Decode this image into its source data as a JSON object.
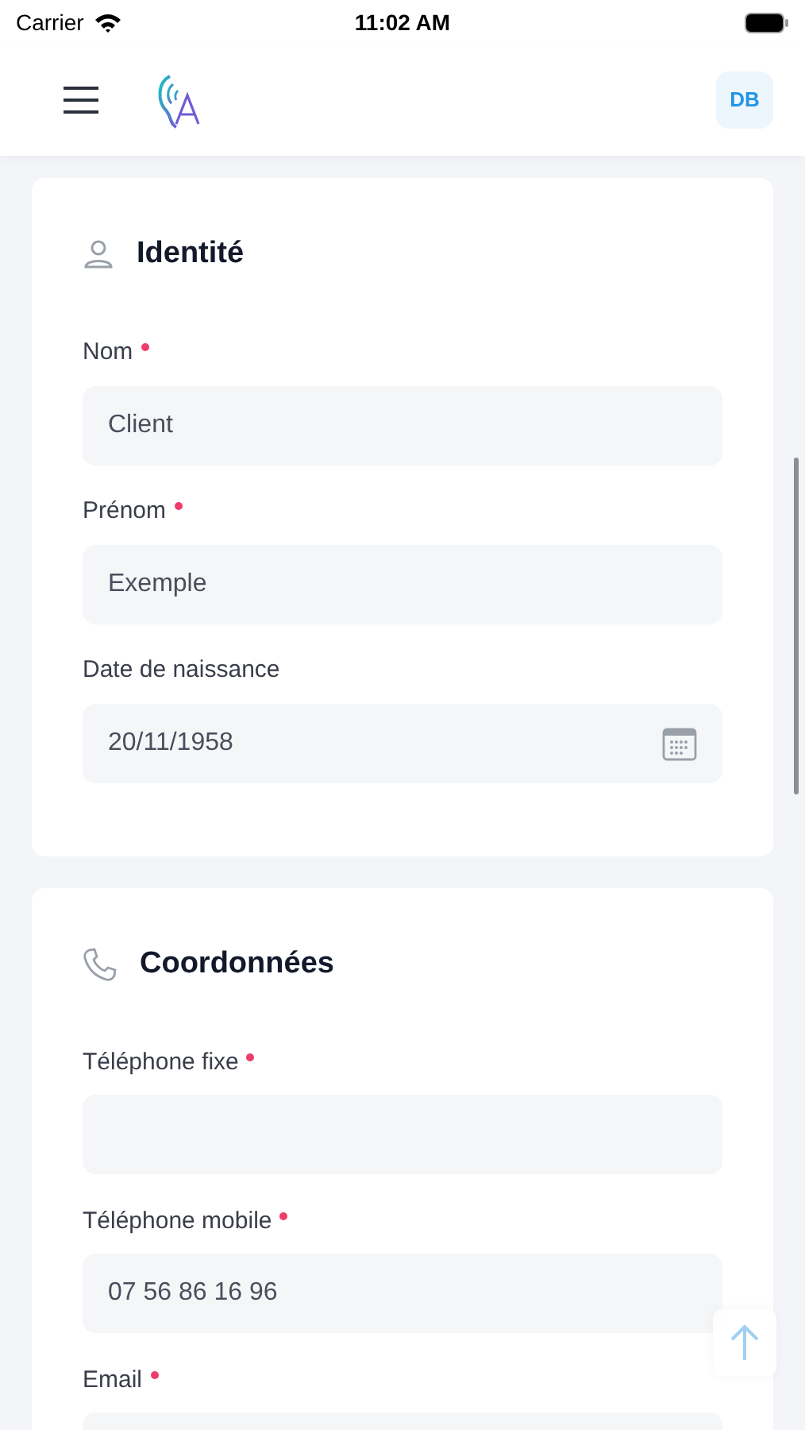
{
  "status_bar": {
    "carrier": "Carrier",
    "time": "11:02 AM"
  },
  "header": {
    "avatar_initials": "DB"
  },
  "sections": [
    {
      "title": "Identité",
      "fields": [
        {
          "label": "Nom",
          "required": true,
          "value": "Client",
          "kind": "text"
        },
        {
          "label": "Prénom",
          "required": true,
          "value": "Exemple",
          "kind": "text"
        },
        {
          "label": "Date de naissance",
          "required": false,
          "value": "20/11/1958",
          "kind": "date"
        }
      ]
    },
    {
      "title": "Coordonnées",
      "fields": [
        {
          "label": "Téléphone fixe",
          "required": true,
          "kind": "text"
        },
        {
          "label": "Téléphone mobile",
          "required": true,
          "value": "07 56 86 16 96",
          "kind": "text"
        },
        {
          "label": "Email",
          "required": true,
          "kind": "text"
        }
      ]
    }
  ]
}
